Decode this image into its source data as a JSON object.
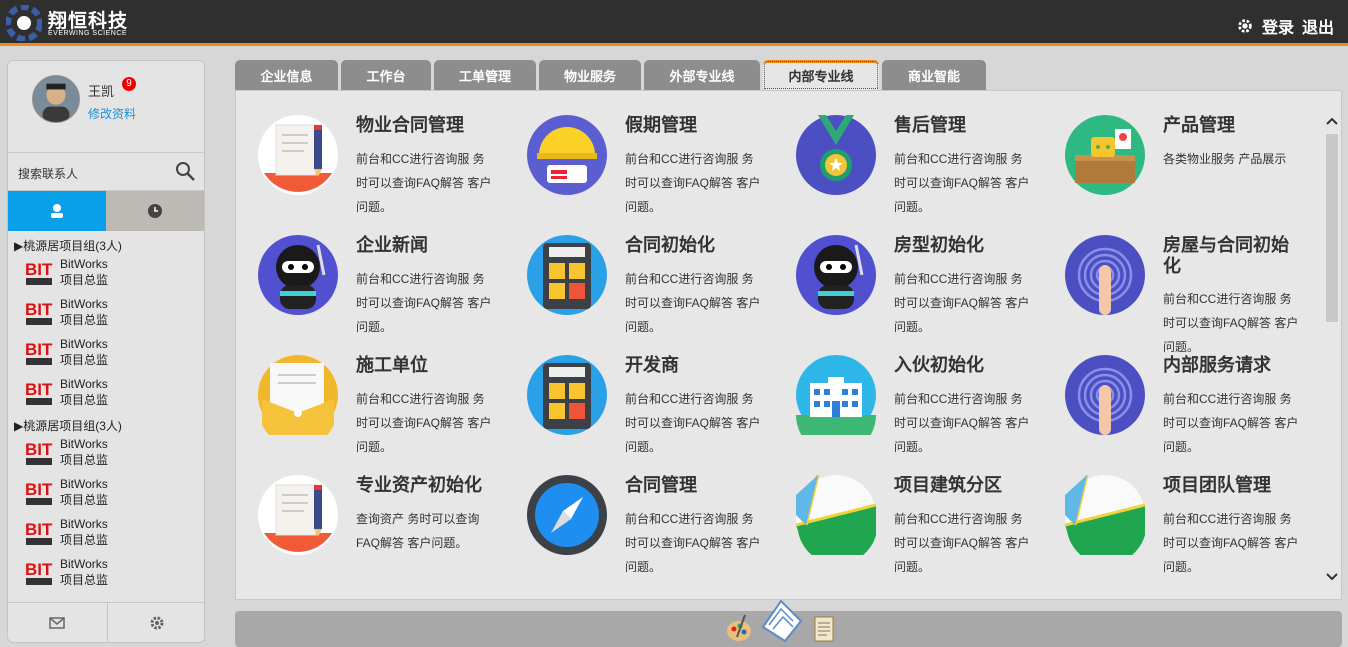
{
  "header": {
    "logo_text": "翔恒科技",
    "logo_sub": "EVERWING SCIENCE",
    "login": "登录",
    "logout": "退出"
  },
  "profile": {
    "name": "王凯",
    "badge": "9",
    "edit": "修改资料"
  },
  "search": {
    "label": "搜索联系人"
  },
  "contacts": {
    "group1": "▶桃源居项目组(3人)",
    "group2": "▶桃源居项目组(3人)",
    "name": "BitWorks",
    "role": "项目总监",
    "role_cut": "项目总监"
  },
  "tabs": [
    "企业信息",
    "工作台",
    "工单管理",
    "物业服务",
    "外部专业线",
    "内部专业线",
    "商业智能"
  ],
  "cards": [
    {
      "title": "物业合同管理",
      "desc": "前台和CC进行咨询服 务时可以查询FAQ解答 客户问题。"
    },
    {
      "title": "假期管理",
      "desc": "前台和CC进行咨询服 务时可以查询FAQ解答 客户问题。"
    },
    {
      "title": "售后管理",
      "desc": "前台和CC进行咨询服 务时可以查询FAQ解答 客户问题。"
    },
    {
      "title": "产品管理",
      "desc": "各类物业服务 产品展示"
    },
    {
      "title": "企业新闻",
      "desc": "前台和CC进行咨询服 务时可以查询FAQ解答 客户问题。"
    },
    {
      "title": "合同初始化",
      "desc": "前台和CC进行咨询服 务时可以查询FAQ解答 客户问题。"
    },
    {
      "title": "房型初始化",
      "desc": "前台和CC进行咨询服 务时可以查询FAQ解答 客户问题。"
    },
    {
      "title": "房屋与合同初始化",
      "desc": "前台和CC进行咨询服 务时可以查询FAQ解答 客户问题。"
    },
    {
      "title": "施工单位",
      "desc": "前台和CC进行咨询服 务时可以查询FAQ解答 客户问题。"
    },
    {
      "title": "开发商",
      "desc": "前台和CC进行咨询服 务时可以查询FAQ解答 客户问题。"
    },
    {
      "title": "入伙初始化",
      "desc": "前台和CC进行咨询服 务时可以查询FAQ解答 客户问题。"
    },
    {
      "title": "内部服务请求",
      "desc": "前台和CC进行咨询服 务时可以查询FAQ解答 客户问题。"
    },
    {
      "title": "专业资产初始化",
      "desc": "查询资产 务时可以查询FAQ解答 客户问题。"
    },
    {
      "title": "合同管理",
      "desc": "前台和CC进行咨询服 务时可以查询FAQ解答 客户问题。"
    },
    {
      "title": "项目建筑分区",
      "desc": "前台和CC进行咨询服 务时可以查询FAQ解答 客户问题。"
    },
    {
      "title": "项目团队管理",
      "desc": "前台和CC进行咨询服 务时可以查询FAQ解答 客户问题。"
    }
  ],
  "icons": [
    "document-icon",
    "helmet-icon",
    "medal-icon",
    "shop-icon",
    "ninja-icon",
    "calculator-icon",
    "ninja-icon",
    "fingerprint-icon",
    "envelope-icon",
    "calculator-icon",
    "building-icon",
    "fingerprint-icon",
    "document-icon",
    "compass-icon",
    "map-icon",
    "map-icon"
  ]
}
